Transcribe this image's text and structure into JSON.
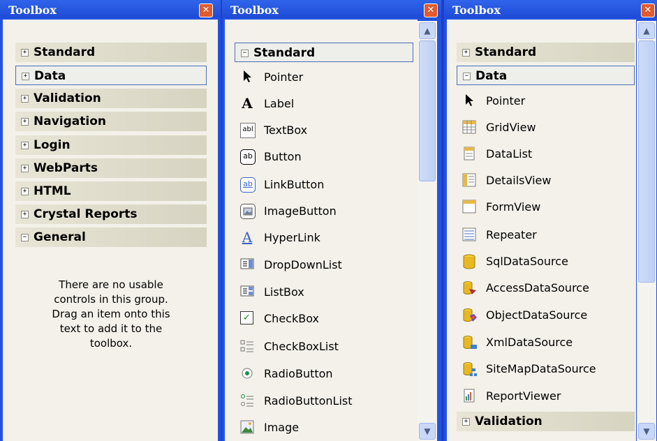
{
  "panels": [
    {
      "title": "Toolbox",
      "groups": [
        "Standard",
        "Data",
        "Validation",
        "Navigation",
        "Login",
        "WebParts",
        "HTML",
        "Crystal Reports",
        "General"
      ],
      "empty_message_lines": [
        "There are no usable",
        "controls in this group.",
        "Drag an item onto this",
        "text to add it to the",
        "toolbox."
      ]
    },
    {
      "title": "Toolbox",
      "group": "Standard",
      "items": [
        "Pointer",
        "Label",
        "TextBox",
        "Button",
        "LinkButton",
        "ImageButton",
        "HyperLink",
        "DropDownList",
        "ListBox",
        "CheckBox",
        "CheckBoxList",
        "RadioButton",
        "RadioButtonList",
        "Image"
      ]
    },
    {
      "title": "Toolbox",
      "groups_top": [
        "Standard",
        "Data"
      ],
      "items": [
        "Pointer",
        "GridView",
        "DataList",
        "DetailsView",
        "FormView",
        "Repeater",
        "SqlDataSource",
        "AccessDataSource",
        "ObjectDataSource",
        "XmlDataSource",
        "SiteMapDataSource",
        "ReportViewer"
      ],
      "groups_bottom": [
        "Validation"
      ]
    }
  ],
  "glyphs": {
    "close": "✕",
    "expand": "+",
    "collapse": "−",
    "scroll_up": "▲",
    "scroll_down": "▼"
  },
  "icons": {
    "Pointer": "pointer-icon",
    "Label": "label-icon",
    "TextBox": "textbox-icon",
    "Button": "button-icon",
    "LinkButton": "linkbutton-icon",
    "ImageButton": "imagebutton-icon",
    "HyperLink": "hyperlink-icon",
    "DropDownList": "dropdownlist-icon",
    "ListBox": "listbox-icon",
    "CheckBox": "checkbox-icon",
    "CheckBoxList": "checkboxlist-icon",
    "RadioButton": "radiobutton-icon",
    "RadioButtonList": "radiobuttonlist-icon",
    "Image": "image-icon",
    "GridView": "gridview-icon",
    "DataList": "datalist-icon",
    "DetailsView": "detailsview-icon",
    "FormView": "formview-icon",
    "Repeater": "repeater-icon",
    "SqlDataSource": "sqldatasource-icon",
    "AccessDataSource": "accessdatasource-icon",
    "ObjectDataSource": "objectdatasource-icon",
    "XmlDataSource": "xmldatasource-icon",
    "SiteMapDataSource": "sitemapdatasource-icon",
    "ReportViewer": "reportviewer-icon"
  },
  "colors": {
    "title_bar": "#2352e0",
    "close_button": "#e25a2d",
    "panel_bg": "#f3f1e9",
    "header_bg": "#d7d3c1",
    "selection_border": "#4b6fb3"
  }
}
